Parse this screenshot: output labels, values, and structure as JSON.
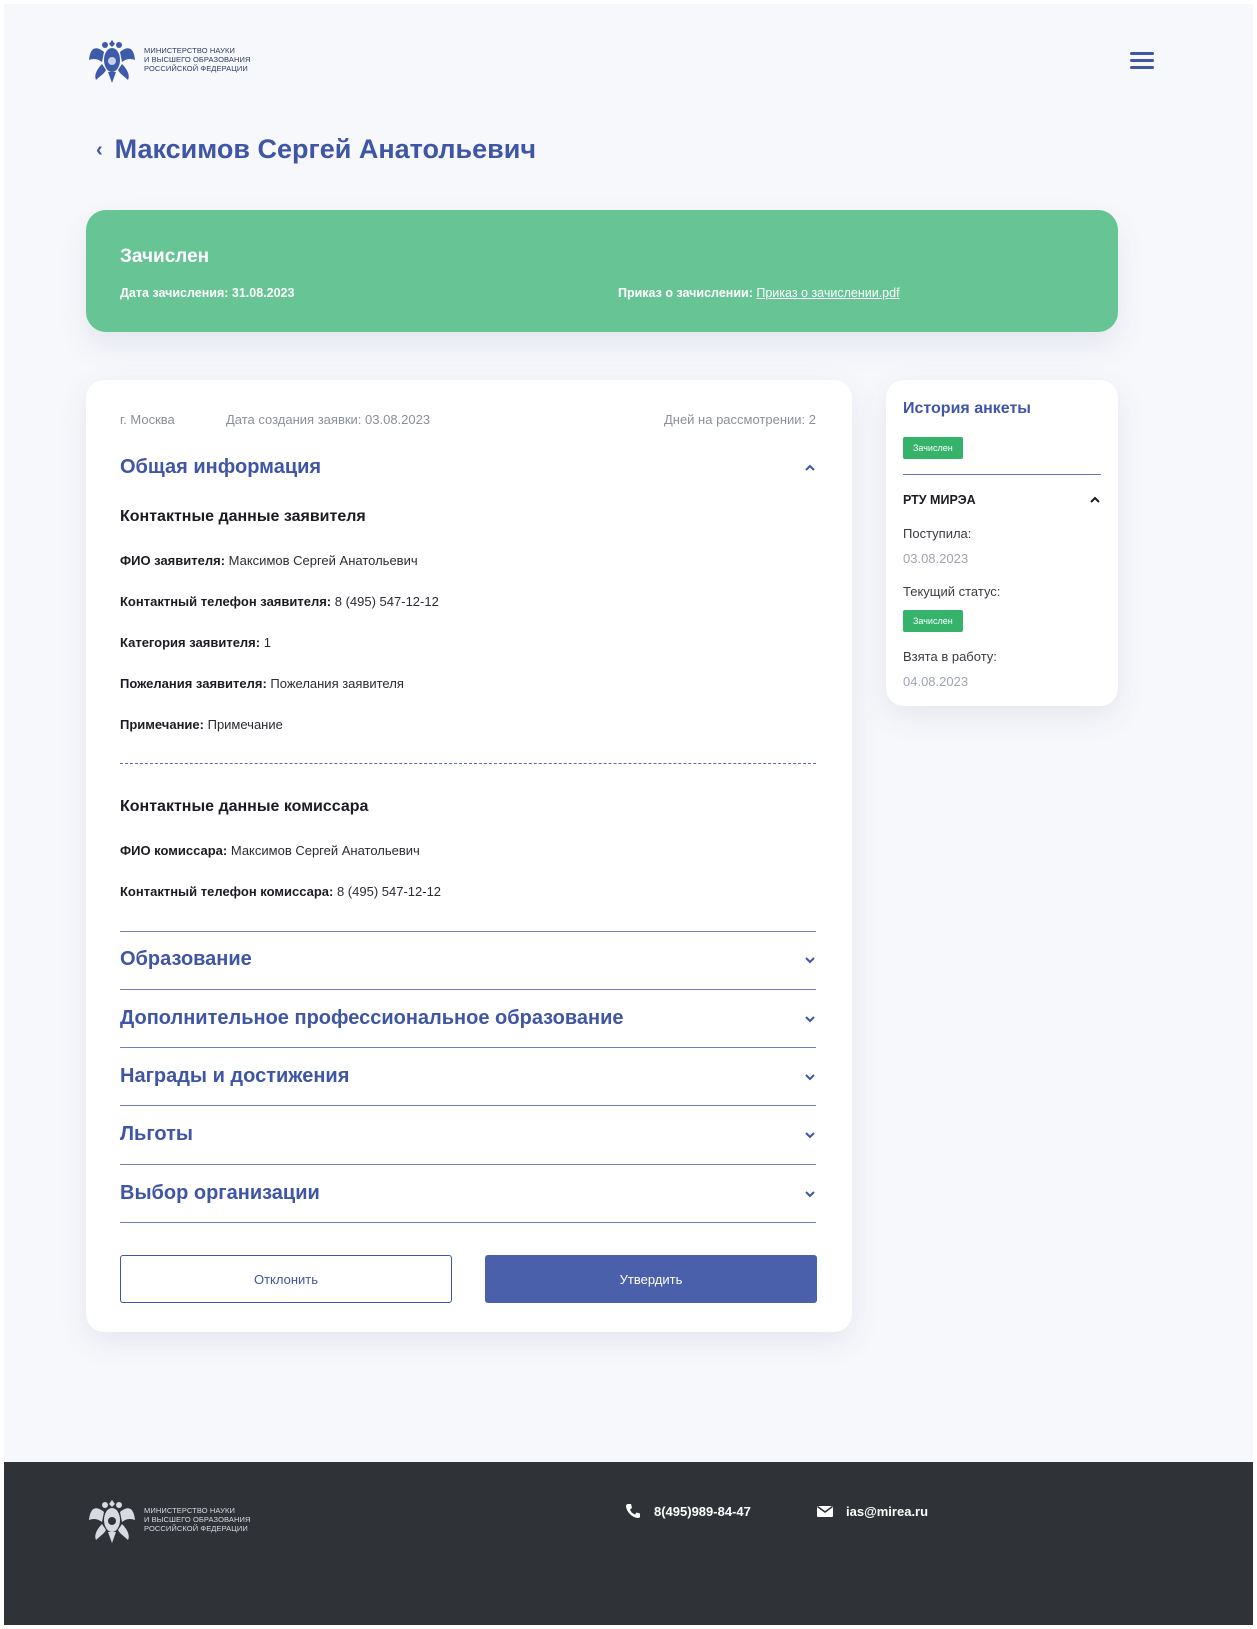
{
  "header": {
    "logo_lines": [
      "МИНИСТЕРСТВО НАУКИ",
      "И ВЫСШЕГО ОБРАЗОВАНИЯ",
      "РОССИЙСКОЙ ФЕДЕРАЦИИ"
    ]
  },
  "page_title": "Максимов Сергей Анатольевич",
  "status": {
    "title": "Зачислен",
    "date_label": "Дата зачисления: 31.08.2023",
    "order_label": "Приказ о зачислении:",
    "order_link": "Приказ о зачислении.pdf",
    "color": "#66c495"
  },
  "application": {
    "city": "г. Москва",
    "created": "Дата создания заявки: 03.08.2023",
    "days": "Дней на рассмотрении: 2",
    "general_section": "Общая информация",
    "applicant_heading": "Контактные данные заявителя",
    "applicant_fields": [
      {
        "label": "ФИО заявителя:",
        "value": " Максимов Сергей Анатольевич"
      },
      {
        "label": "Контактный телефон заявителя:",
        "value": " 8 (495) 547-12-12"
      },
      {
        "label": "Категория заявителя:",
        "value": " 1"
      },
      {
        "label": "Пожелания заявителя:",
        "value": " Пожелания заявителя"
      },
      {
        "label": "Примечание:",
        "value": " Примечание"
      }
    ],
    "commissar_heading": "Контактные данные комиссара",
    "commissar_fields": [
      {
        "label": "ФИО комиссара:",
        "value": " Максимов Сергей Анатольевич"
      },
      {
        "label": "Контактный телефон комиссара:",
        "value": " 8 (495) 547-12-12"
      }
    ],
    "collapsed_sections": [
      "Образование",
      "Дополнительное профессиональное образование",
      "Награды и достижения",
      "Льготы",
      "Выбор организации"
    ],
    "reject_label": "Отклонить",
    "approve_label": "Утвердить"
  },
  "history": {
    "title": "История анкеты",
    "badge": "Зачислен",
    "org": "РТУ МИРЭА",
    "received_label": "Поступила:",
    "received_value": "03.08.2023",
    "status_label": "Текущий статус:",
    "status_badge": "Зачислен",
    "taken_label": "Взята в работу:",
    "taken_value": "04.08.2023"
  },
  "footer": {
    "logo_lines": [
      "МИНИСТЕРСТВО НАУКИ",
      "И ВЫСШЕГО ОБРАЗОВАНИЯ",
      "РОССИЙСКОЙ ФЕДЕРАЦИИ"
    ],
    "phone": "8(495)989-84-47",
    "email": "ias@mirea.ru"
  },
  "colors": {
    "accent": "#3f55a5",
    "success": "#66c495",
    "badge": "#35b36b",
    "footer": "#2f3236"
  },
  "icons": [
    "coat-of-arms-icon",
    "menu-icon",
    "chevron-left-icon",
    "chevron-up-icon",
    "chevron-down-icon",
    "phone-icon",
    "mail-icon"
  ]
}
